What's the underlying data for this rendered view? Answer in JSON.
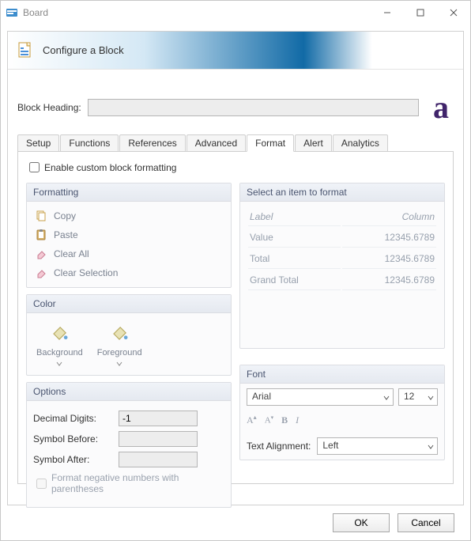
{
  "window": {
    "title": "Board"
  },
  "banner": {
    "title": "Configure a Block"
  },
  "heading": {
    "label": "Block Heading:",
    "value": "",
    "logo": "a"
  },
  "tabs": {
    "items": [
      "Setup",
      "Functions",
      "References",
      "Advanced",
      "Format",
      "Alert",
      "Analytics"
    ],
    "active": 4
  },
  "format": {
    "enable_label": "Enable custom block formatting",
    "enable_checked": false,
    "formatting": {
      "title": "Formatting",
      "copy": "Copy",
      "paste": "Paste",
      "clear_all": "Clear All",
      "clear_selection": "Clear Selection"
    },
    "color": {
      "title": "Color",
      "background": "Background",
      "foreground": "Foreground"
    },
    "options": {
      "title": "Options",
      "decimal_digits_label": "Decimal Digits:",
      "decimal_digits_value": "-1",
      "symbol_before_label": "Symbol Before:",
      "symbol_before_value": "",
      "symbol_after_label": "Symbol After:",
      "symbol_after_value": "",
      "neg_paren_label": "Format negative numbers with parentheses",
      "neg_paren_checked": false
    },
    "select_item": {
      "title": "Select an item to format",
      "col1_header": "Label",
      "col2_header": "Column",
      "rows": [
        {
          "label": "Value",
          "num": "12345.6789"
        },
        {
          "label": "Total",
          "num": "12345.6789"
        },
        {
          "label": "Grand Total",
          "num": "12345.6789"
        }
      ]
    },
    "font": {
      "title": "Font",
      "family": "Arial",
      "size": "12",
      "alignment_label": "Text Alignment:",
      "alignment_value": "Left"
    }
  },
  "buttons": {
    "ok": "OK",
    "cancel": "Cancel"
  }
}
